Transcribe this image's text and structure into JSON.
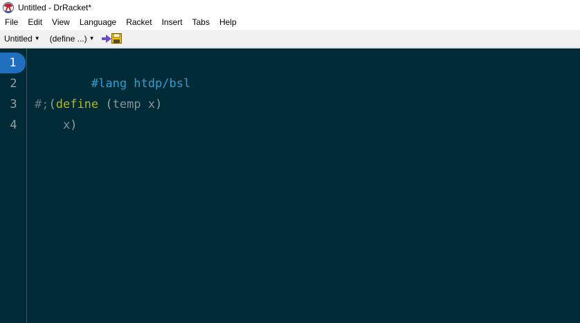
{
  "window": {
    "title": "Untitled - DrRacket*",
    "icon": "drracket-lambda-icon"
  },
  "menu": {
    "items": [
      "File",
      "Edit",
      "View",
      "Language",
      "Racket",
      "Insert",
      "Tabs",
      "Help"
    ]
  },
  "toolbar": {
    "file_dropdown": "Untitled",
    "define_dropdown": "(define ...)",
    "icons": [
      "run-arrow-icon",
      "save-floppy-icon"
    ]
  },
  "editor": {
    "active_line": 1,
    "line_numbers": [
      "1",
      "2",
      "3",
      "4"
    ],
    "lines": {
      "l1": "#lang htdp/bsl",
      "l3_prefix": "#;",
      "l3_open": "(",
      "l3_keyword": "define",
      "l3_space": " ",
      "l3_open2": "(",
      "l3_name": "temp",
      "l3_space2": " ",
      "l3_arg": "x",
      "l3_close": ")",
      "l4_indent": "    ",
      "l4_body": "x",
      "l4_close": ")"
    },
    "colors": {
      "background": "#002b36",
      "lang": "#2aa1d3",
      "keyword": "#b5b91a",
      "active_line_badge": "#1f6fbf"
    }
  }
}
